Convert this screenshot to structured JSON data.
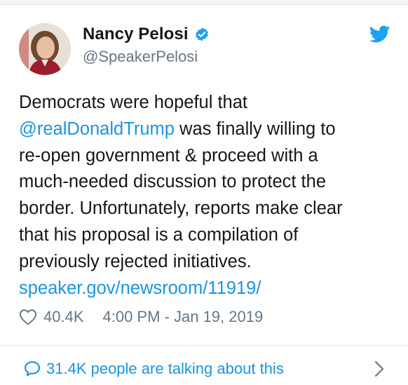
{
  "author": {
    "display_name": "Nancy Pelosi",
    "handle": "@SpeakerPelosi",
    "verified": true,
    "avatar_icon": "profile-photo"
  },
  "tweet": {
    "lines": [
      [
        {
          "text": "Democrats were hopeful that",
          "link": false
        }
      ],
      [
        {
          "text": "@realDonaldTrump",
          "link": true
        },
        {
          "text": " was finally willing to",
          "link": false
        }
      ],
      [
        {
          "text": "re-open government & proceed with a",
          "link": false
        }
      ],
      [
        {
          "text": "much-needed discussion to protect the",
          "link": false
        }
      ],
      [
        {
          "text": "border. Unfortunately, reports make clear",
          "link": false
        }
      ],
      [
        {
          "text": "that his proposal is a compilation of",
          "link": false
        }
      ],
      [
        {
          "text": "previously rejected initiatives.",
          "link": false
        }
      ],
      [
        {
          "text": "speaker.gov/newsroom/11919/",
          "link": true
        }
      ]
    ]
  },
  "meta": {
    "like_count": "40.4K",
    "timestamp": "4:00 PM - Jan 19, 2019"
  },
  "footer": {
    "talking_text": "31.4K people are talking about this"
  },
  "icons": {
    "logo": "twitter-bird-icon",
    "verified": "verified-badge-icon",
    "like": "heart-icon",
    "reply": "speech-bubble-icon",
    "more": "chevron-right-icon"
  },
  "colors": {
    "link": "#1b95e0",
    "text": "#14171a",
    "secondary": "#657786",
    "verified": "#1da1f2",
    "twitter_blue": "#1da1f2"
  }
}
